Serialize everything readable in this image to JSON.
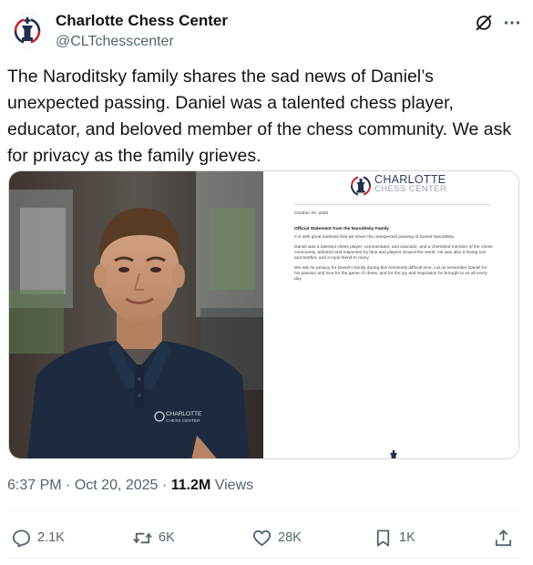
{
  "author": {
    "name": "Charlotte Chess Center",
    "handle": "@CLTchesscenter"
  },
  "tweet": {
    "text": "The Naroditsky family shares the sad news of Daniel’s unexpected passing. Daniel was a talented chess player, educator, and beloved member of the chess community. We ask for privacy as the family grieves."
  },
  "media": {
    "shirt_logo_line1": "CHARLOTTE",
    "shirt_logo_line2": "CHESS CENTER",
    "letter": {
      "brand_line1": "CHARLOTTE",
      "brand_line2": "CHESS CENTER",
      "date": "October 20, 2025",
      "heading": "Official Statement from the Naroditsky Family",
      "p1": "It is with great sadness that we share the unexpected passing of Daniel Naroditsky.",
      "p2": "Daniel was a talented chess player, commentator, and educator, and a cherished member of the chess community, admired and respected by fans and players around the world. He was also a loving son and brother, and a loyal friend to many.",
      "p3": "We ask for privacy for Daniel’s family during this extremely difficult time. Let us remember Daniel for his passion and love for the game of chess, and for the joy and inspiration he brought to us all every day."
    }
  },
  "meta": {
    "time": "6:37 PM",
    "date": "Oct 20, 2025",
    "views_count": "11.2M",
    "views_label": "Views",
    "sep": "·"
  },
  "actions": {
    "replies": "2.1K",
    "reposts": "6K",
    "likes": "28K",
    "bookmarks": "1K"
  },
  "colors": {
    "text": "#0f1419",
    "muted": "#536471",
    "border": "#cfd9de",
    "brand_red": "#c8232c",
    "brand_navy": "#1f2f4d"
  },
  "icons": [
    "grok-icon",
    "more-icon",
    "reply-icon",
    "repost-icon",
    "like-icon",
    "bookmark-icon",
    "share-icon"
  ]
}
